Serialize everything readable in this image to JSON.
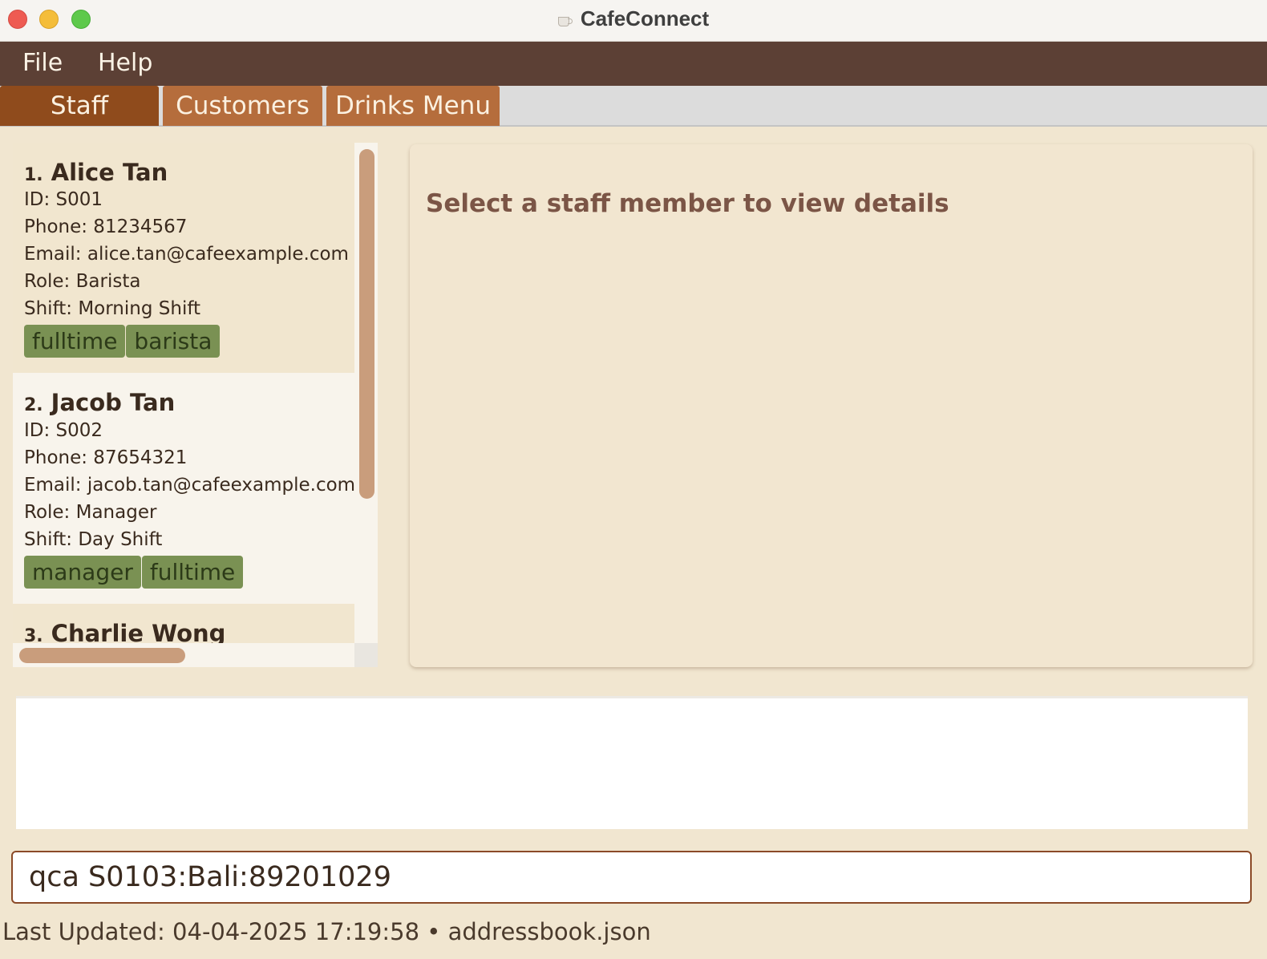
{
  "window": {
    "title": "CafeConnect",
    "icon": "coffee-cup-icon"
  },
  "menu": {
    "items": [
      "File",
      "Help"
    ]
  },
  "tabs": [
    {
      "label": "Staff",
      "active": true
    },
    {
      "label": "Customers",
      "active": false
    },
    {
      "label": "Drinks Menu",
      "active": false
    }
  ],
  "staff_list": [
    {
      "index": "1.",
      "name": "Alice Tan",
      "id": "ID: S001",
      "phone": "Phone: 81234567",
      "email": "Email: alice.tan@cafeexample.com",
      "role": "Role: Barista",
      "shift": "Shift: Morning Shift",
      "tags": [
        "fulltime",
        "barista"
      ]
    },
    {
      "index": "2.",
      "name": "Jacob Tan",
      "id": "ID: S002",
      "phone": "Phone: 87654321",
      "email": "Email: jacob.tan@cafeexample.com",
      "role": "Role: Manager",
      "shift": "Shift: Day Shift",
      "tags": [
        "manager",
        "fulltime"
      ]
    },
    {
      "index": "3.",
      "name": "Charlie Wong"
    }
  ],
  "detail": {
    "placeholder": "Select a staff member to view details"
  },
  "result": {
    "text": ""
  },
  "command": {
    "value": "qca S0103:Bali:89201029",
    "placeholder": ""
  },
  "status": {
    "text": "Last Updated: 04-04-2025 17:19:58 • addressbook.json"
  },
  "colors": {
    "menubar": "#5c4035",
    "tab_active": "#8f4b1c",
    "tab_inactive": "#b56d3c",
    "tag": "#7a9153",
    "scroll_thumb": "#c99d7c",
    "detail_text": "#7b5546",
    "input_border": "#8b4a28"
  }
}
